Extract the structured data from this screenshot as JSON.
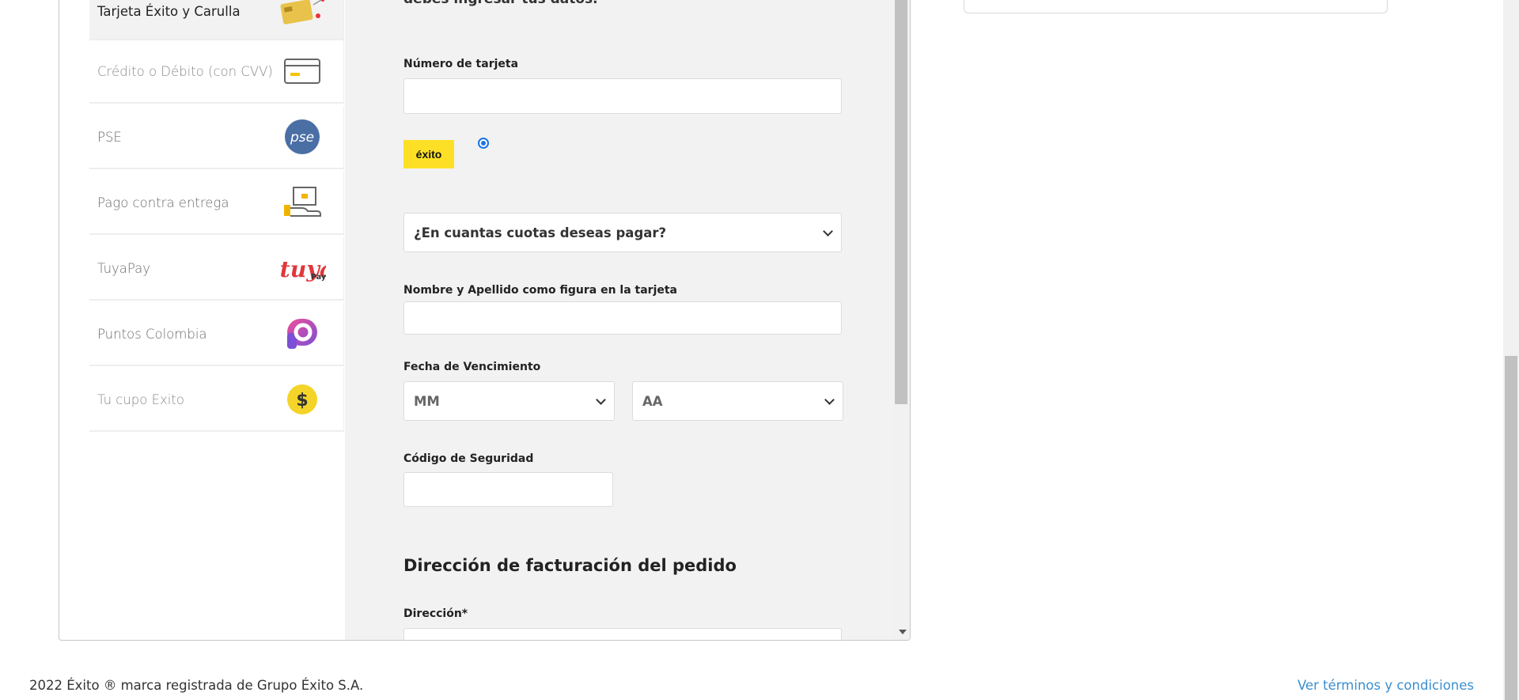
{
  "methods": [
    {
      "label": "Tarjeta Éxito y Carulla",
      "icon": "exito-card-icon",
      "active": true
    },
    {
      "label": "Crédito o Débito (con CVV)",
      "icon": "credit-card-icon"
    },
    {
      "label": "PSE",
      "icon": "pse-icon",
      "icon_text": "pse"
    },
    {
      "label": "Pago contra entrega",
      "icon": "delivery-box-icon"
    },
    {
      "label": "TuyaPay",
      "icon": "tuyapay-icon",
      "icon_text": "tuya",
      "icon_sub": "Pay"
    },
    {
      "label": "Puntos Colombia",
      "icon": "puntos-colombia-icon"
    },
    {
      "label": "Tu cupo Exito",
      "icon": "dollar-coin-icon",
      "icon_text": "$"
    }
  ],
  "form": {
    "cut_heading": "debes ingresar tus datos.",
    "card_number_label": "Número de tarjeta",
    "card_number_value": "",
    "brand_logo": "éxito",
    "installments_placeholder": "¿En cuantas cuotas deseas pagar?",
    "name_label": "Nombre y Apellido como figura en la tarjeta",
    "expiry_label": "Fecha de Vencimiento",
    "month_placeholder": "MM",
    "year_placeholder": "AA",
    "cvv_label": "Código de Seguridad",
    "billing_title": "Dirección de facturación del pedido",
    "address_label": "Dirección*"
  },
  "footer": {
    "copyright": "2022 Éxito ® marca registrada de Grupo Éxito S.A.",
    "terms_link": "Ver términos y condiciones"
  },
  "colors": {
    "exito_yellow": "#fde025",
    "link_blue": "#3a8fd0",
    "radio_blue": "#1a73e8"
  }
}
